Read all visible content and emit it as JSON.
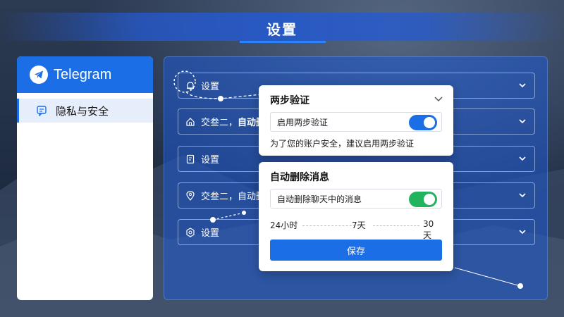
{
  "header": {
    "title": "设置"
  },
  "sidebar": {
    "brand": "Telegram",
    "items": [
      {
        "label": "隐私与安全",
        "icon": "message-square-icon"
      }
    ]
  },
  "main": {
    "rows": [
      {
        "label": "设置",
        "bold": "",
        "icon": "bell-icon"
      },
      {
        "label": "交叁二，",
        "bold": "自动删",
        "icon": "home-icon"
      },
      {
        "label": "设置",
        "bold": "",
        "icon": "document-icon"
      },
      {
        "label": "交叁二，自动删",
        "bold": "",
        "icon": "location-pin-icon"
      },
      {
        "label": "设置",
        "bold": "",
        "icon": "gear-icon"
      }
    ]
  },
  "two_step": {
    "title": "两步验证",
    "toggle_label": "启用两步验证",
    "enabled": true,
    "hint": "为了您的账户安全，建议启用两步验证"
  },
  "auto_delete": {
    "title": "自动删除消息",
    "toggle_label": "自动删除聊天中的消息",
    "enabled": true,
    "options": [
      "24小时",
      "7天",
      "30天"
    ],
    "save_label": "保存"
  },
  "colors": {
    "accent": "#1b6ee6",
    "toggle_blue": "#1b6ee6",
    "toggle_green": "#22b35e"
  }
}
